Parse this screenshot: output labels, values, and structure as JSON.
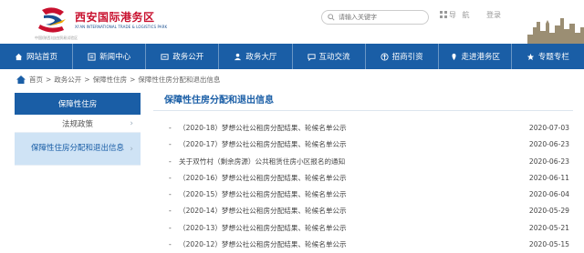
{
  "logo": {
    "name_cn": "西安国际港务区",
    "name_en": "XI'AN INTERNATIONAL TRADE & LOGISTICS PARK",
    "sub": "中国(陕西)自由贸易试验区"
  },
  "search": {
    "placeholder": "请输入关键字"
  },
  "toolbar": {
    "nav_label": "导 航",
    "login_label": "登录"
  },
  "nav": [
    {
      "label": "网站首页",
      "icon": "home-icon"
    },
    {
      "label": "新闻中心",
      "icon": "news-icon"
    },
    {
      "label": "政务公开",
      "icon": "gov-icon"
    },
    {
      "label": "政务大厅",
      "icon": "hall-icon"
    },
    {
      "label": "互动交流",
      "icon": "chat-icon"
    },
    {
      "label": "招商引资",
      "icon": "invest-icon"
    },
    {
      "label": "走进港务区",
      "icon": "area-icon"
    },
    {
      "label": "专题专栏",
      "icon": "topic-icon"
    }
  ],
  "breadcrumb": [
    "首页",
    "政务公开",
    "保障性住房",
    "保障性住房分配和退出信息"
  ],
  "sidebar": {
    "title": "保障性住房",
    "items": [
      {
        "label": "法规政策",
        "active": false
      },
      {
        "label": "保障性住房分配和退出信息",
        "active": true
      }
    ]
  },
  "main": {
    "title": "保障性住房分配和退出信息",
    "rows": [
      {
        "text": "（2020-18）梦想公社公租房分配结果、轮候名单公示",
        "date": "2020-07-03"
      },
      {
        "text": "（2020-17）梦想公社公租房分配结果、轮候名单公示",
        "date": "2020-06-23"
      },
      {
        "text": "关于双竹村（剩余房源）公共租赁住房小区报名的通知",
        "date": "2020-06-23"
      },
      {
        "text": "（2020-16）梦想公社公租房分配结果、轮候名单公示",
        "date": "2020-06-11"
      },
      {
        "text": "（2020-15）梦想公社公租房分配结果、轮候名单公示",
        "date": "2020-06-04"
      },
      {
        "text": "（2020-14）梦想公社公租房分配结果、轮候名单公示",
        "date": "2020-05-29"
      },
      {
        "text": "（2020-13）梦想公社公租房分配结果、轮候名单公示",
        "date": "2020-05-21"
      },
      {
        "text": "（2020-12）梦想公社公租房分配结果、轮候名单公示",
        "date": "2020-05-15"
      }
    ]
  },
  "colors": {
    "brand_blue": "#1a5ea6",
    "brand_red": "#c8102e",
    "active_bg": "#cfe3f5"
  }
}
